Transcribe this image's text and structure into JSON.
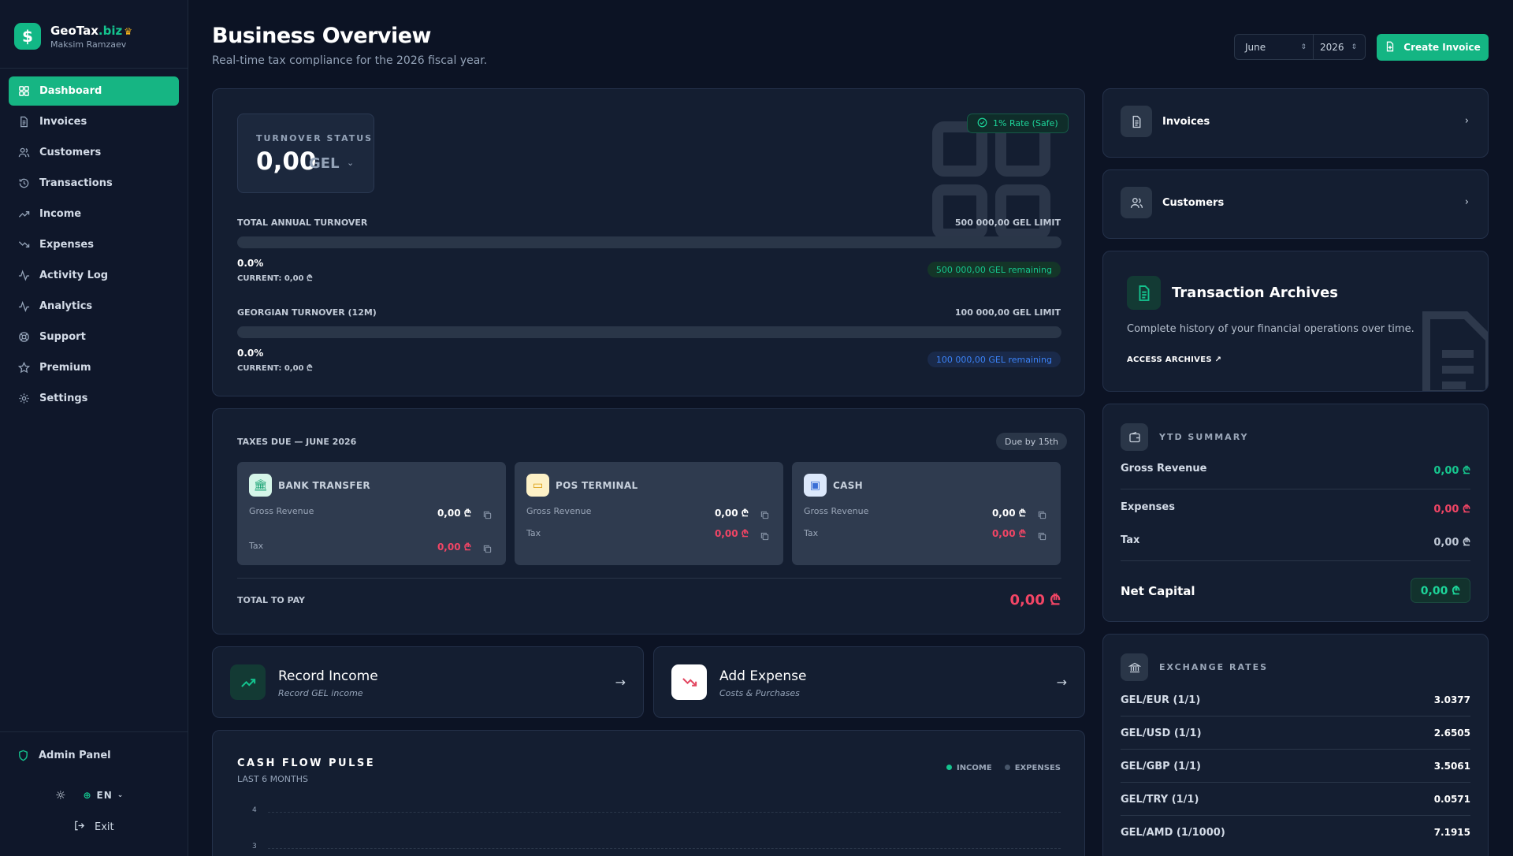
{
  "brand": {
    "name": "GeoTax",
    "suffix": ".biz",
    "user": "Maksim Ramzaev",
    "logo_symbol": "$"
  },
  "sidebar": {
    "items": [
      {
        "label": "Dashboard",
        "icon": "grid-icon",
        "active": true
      },
      {
        "label": "Invoices",
        "icon": "file-icon"
      },
      {
        "label": "Customers",
        "icon": "users-icon"
      },
      {
        "label": "Transactions",
        "icon": "history-icon"
      },
      {
        "label": "Income",
        "icon": "trending-up-icon"
      },
      {
        "label": "Expenses",
        "icon": "trending-down-icon"
      },
      {
        "label": "Activity Log",
        "icon": "activity-icon"
      },
      {
        "label": "Analytics",
        "icon": "pulse-icon"
      },
      {
        "label": "Support",
        "icon": "lifebuoy-icon"
      },
      {
        "label": "Premium",
        "icon": "star-icon"
      },
      {
        "label": "Settings",
        "icon": "gear-icon"
      }
    ],
    "admin_label": "Admin Panel",
    "language": "EN",
    "exit_label": "Exit"
  },
  "header": {
    "title": "Business Overview",
    "subtitle": "Real-time tax compliance for the 2026 fiscal year.",
    "month": "June",
    "year": "2026",
    "create_label": "Create Invoice"
  },
  "turnover": {
    "label": "TURNOVER STATUS",
    "value": "0,00",
    "currency": "GEL",
    "rate_badge": "1% Rate (Safe)",
    "annual": {
      "label": "TOTAL ANNUAL TURNOVER",
      "limit": "500 000,00 GEL LIMIT",
      "progress": 0.0,
      "pct": "0.0%",
      "current": "CURRENT: 0,00 ₾",
      "remaining": "500 000,00 GEL remaining"
    },
    "georgian": {
      "label": "GEORGIAN TURNOVER (12M)",
      "limit": "100 000,00 GEL LIMIT",
      "progress": 0.0,
      "pct": "0.0%",
      "current": "CURRENT: 0,00 ₾",
      "remaining": "100 000,00 GEL remaining"
    }
  },
  "taxes": {
    "title": "TAXES DUE — JUNE 2026",
    "due_badge": "Due by 15th",
    "methods": [
      {
        "name": "BANK TRANSFER",
        "gross_label": "Gross Revenue",
        "gross": "0,00 ₾",
        "tax_label": "Tax",
        "tax": "0,00 ₾"
      },
      {
        "name": "POS TERMINAL",
        "gross_label": "Gross Revenue",
        "gross": "0,00 ₾",
        "tax_label": "Tax",
        "tax": "0,00 ₾"
      },
      {
        "name": "CASH",
        "gross_label": "Gross Revenue",
        "gross": "0,00 ₾",
        "tax_label": "Tax",
        "tax": "0,00 ₾"
      }
    ],
    "total_label": "TOTAL TO PAY",
    "total": "0,00 ₾"
  },
  "actions": {
    "income": {
      "title": "Record Income",
      "subtitle": "Record GEL income"
    },
    "expense": {
      "title": "Add Expense",
      "subtitle": "Costs & Purchases"
    }
  },
  "cashflow": {
    "title": "CASH FLOW PULSE",
    "subtitle": "LAST 6 MONTHS",
    "legend_income": "INCOME",
    "legend_expenses": "EXPENSES",
    "ticks": [
      "4",
      "3"
    ],
    "colors": {
      "income": "#14c38e",
      "expenses": "#475569"
    }
  },
  "right": {
    "invoices_label": "Invoices",
    "customers_label": "Customers",
    "archives": {
      "title": "Transaction Archives",
      "description": "Complete history of your financial operations over time.",
      "link": "ACCESS ARCHIVES"
    },
    "summary": {
      "title": "YTD SUMMARY",
      "rows": [
        {
          "label": "Gross Revenue",
          "value": "0,00 ₾",
          "color": "#16c68e"
        },
        {
          "label": "Expenses",
          "value": "0,00 ₾",
          "color": "#f24565"
        },
        {
          "label": "Tax",
          "value": "0,00 ₾",
          "color": "#c0c9d6"
        }
      ],
      "net_label": "Net Capital",
      "net_value": "0,00 ₾"
    },
    "rates": {
      "title": "EXCHANGE RATES",
      "rows": [
        {
          "pair": "GEL/EUR (1/1)",
          "value": "3.0377"
        },
        {
          "pair": "GEL/USD (1/1)",
          "value": "2.6505"
        },
        {
          "pair": "GEL/GBP (1/1)",
          "value": "3.5061"
        },
        {
          "pair": "GEL/TRY (1/1)",
          "value": "0.0571"
        },
        {
          "pair": "GEL/AMD (1/1000)",
          "value": "7.1915"
        }
      ]
    }
  },
  "colors": {
    "accent": "#14b583",
    "danger": "#f24565",
    "info": "#3b82f6"
  }
}
